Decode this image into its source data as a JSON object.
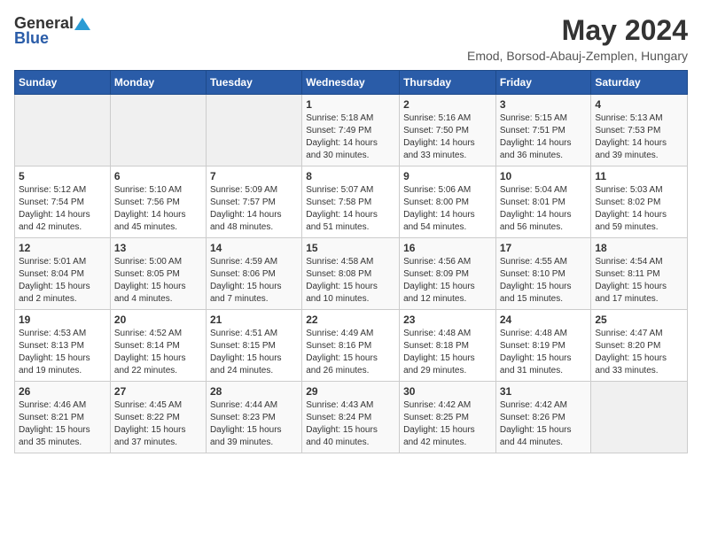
{
  "header": {
    "logo_general": "General",
    "logo_blue": "Blue",
    "title": "May 2024",
    "subtitle": "Emod, Borsod-Abauj-Zemplen, Hungary"
  },
  "days_of_week": [
    "Sunday",
    "Monday",
    "Tuesday",
    "Wednesday",
    "Thursday",
    "Friday",
    "Saturday"
  ],
  "weeks": [
    [
      {
        "day": "",
        "info": ""
      },
      {
        "day": "",
        "info": ""
      },
      {
        "day": "",
        "info": ""
      },
      {
        "day": "1",
        "info": "Sunrise: 5:18 AM\nSunset: 7:49 PM\nDaylight: 14 hours\nand 30 minutes."
      },
      {
        "day": "2",
        "info": "Sunrise: 5:16 AM\nSunset: 7:50 PM\nDaylight: 14 hours\nand 33 minutes."
      },
      {
        "day": "3",
        "info": "Sunrise: 5:15 AM\nSunset: 7:51 PM\nDaylight: 14 hours\nand 36 minutes."
      },
      {
        "day": "4",
        "info": "Sunrise: 5:13 AM\nSunset: 7:53 PM\nDaylight: 14 hours\nand 39 minutes."
      }
    ],
    [
      {
        "day": "5",
        "info": "Sunrise: 5:12 AM\nSunset: 7:54 PM\nDaylight: 14 hours\nand 42 minutes."
      },
      {
        "day": "6",
        "info": "Sunrise: 5:10 AM\nSunset: 7:56 PM\nDaylight: 14 hours\nand 45 minutes."
      },
      {
        "day": "7",
        "info": "Sunrise: 5:09 AM\nSunset: 7:57 PM\nDaylight: 14 hours\nand 48 minutes."
      },
      {
        "day": "8",
        "info": "Sunrise: 5:07 AM\nSunset: 7:58 PM\nDaylight: 14 hours\nand 51 minutes."
      },
      {
        "day": "9",
        "info": "Sunrise: 5:06 AM\nSunset: 8:00 PM\nDaylight: 14 hours\nand 54 minutes."
      },
      {
        "day": "10",
        "info": "Sunrise: 5:04 AM\nSunset: 8:01 PM\nDaylight: 14 hours\nand 56 minutes."
      },
      {
        "day": "11",
        "info": "Sunrise: 5:03 AM\nSunset: 8:02 PM\nDaylight: 14 hours\nand 59 minutes."
      }
    ],
    [
      {
        "day": "12",
        "info": "Sunrise: 5:01 AM\nSunset: 8:04 PM\nDaylight: 15 hours\nand 2 minutes."
      },
      {
        "day": "13",
        "info": "Sunrise: 5:00 AM\nSunset: 8:05 PM\nDaylight: 15 hours\nand 4 minutes."
      },
      {
        "day": "14",
        "info": "Sunrise: 4:59 AM\nSunset: 8:06 PM\nDaylight: 15 hours\nand 7 minutes."
      },
      {
        "day": "15",
        "info": "Sunrise: 4:58 AM\nSunset: 8:08 PM\nDaylight: 15 hours\nand 10 minutes."
      },
      {
        "day": "16",
        "info": "Sunrise: 4:56 AM\nSunset: 8:09 PM\nDaylight: 15 hours\nand 12 minutes."
      },
      {
        "day": "17",
        "info": "Sunrise: 4:55 AM\nSunset: 8:10 PM\nDaylight: 15 hours\nand 15 minutes."
      },
      {
        "day": "18",
        "info": "Sunrise: 4:54 AM\nSunset: 8:11 PM\nDaylight: 15 hours\nand 17 minutes."
      }
    ],
    [
      {
        "day": "19",
        "info": "Sunrise: 4:53 AM\nSunset: 8:13 PM\nDaylight: 15 hours\nand 19 minutes."
      },
      {
        "day": "20",
        "info": "Sunrise: 4:52 AM\nSunset: 8:14 PM\nDaylight: 15 hours\nand 22 minutes."
      },
      {
        "day": "21",
        "info": "Sunrise: 4:51 AM\nSunset: 8:15 PM\nDaylight: 15 hours\nand 24 minutes."
      },
      {
        "day": "22",
        "info": "Sunrise: 4:49 AM\nSunset: 8:16 PM\nDaylight: 15 hours\nand 26 minutes."
      },
      {
        "day": "23",
        "info": "Sunrise: 4:48 AM\nSunset: 8:18 PM\nDaylight: 15 hours\nand 29 minutes."
      },
      {
        "day": "24",
        "info": "Sunrise: 4:48 AM\nSunset: 8:19 PM\nDaylight: 15 hours\nand 31 minutes."
      },
      {
        "day": "25",
        "info": "Sunrise: 4:47 AM\nSunset: 8:20 PM\nDaylight: 15 hours\nand 33 minutes."
      }
    ],
    [
      {
        "day": "26",
        "info": "Sunrise: 4:46 AM\nSunset: 8:21 PM\nDaylight: 15 hours\nand 35 minutes."
      },
      {
        "day": "27",
        "info": "Sunrise: 4:45 AM\nSunset: 8:22 PM\nDaylight: 15 hours\nand 37 minutes."
      },
      {
        "day": "28",
        "info": "Sunrise: 4:44 AM\nSunset: 8:23 PM\nDaylight: 15 hours\nand 39 minutes."
      },
      {
        "day": "29",
        "info": "Sunrise: 4:43 AM\nSunset: 8:24 PM\nDaylight: 15 hours\nand 40 minutes."
      },
      {
        "day": "30",
        "info": "Sunrise: 4:42 AM\nSunset: 8:25 PM\nDaylight: 15 hours\nand 42 minutes."
      },
      {
        "day": "31",
        "info": "Sunrise: 4:42 AM\nSunset: 8:26 PM\nDaylight: 15 hours\nand 44 minutes."
      },
      {
        "day": "",
        "info": ""
      }
    ]
  ]
}
